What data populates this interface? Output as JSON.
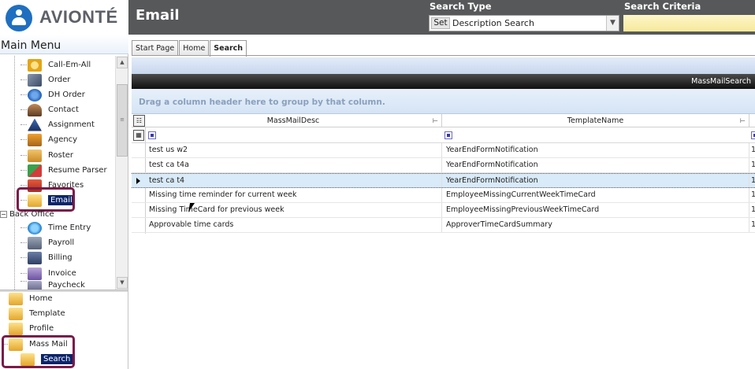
{
  "brand": {
    "name": "AVIONTÉ",
    "color": "#1f6fc0"
  },
  "header": {
    "title": "Email",
    "search_type_label": "Search Type",
    "set_label": "Set",
    "search_type_value": "Description Search",
    "search_criteria_label": "Search Criteria",
    "search_criteria_value": ""
  },
  "sidebar": {
    "title": "Main Menu",
    "items": [
      {
        "label": "Call-Em-All",
        "icon": "phone-icon"
      },
      {
        "label": "Order",
        "icon": "order-icon"
      },
      {
        "label": "DH Order",
        "icon": "globe-icon"
      },
      {
        "label": "Contact",
        "icon": "contact-icon"
      },
      {
        "label": "Assignment",
        "icon": "assignment-icon"
      },
      {
        "label": "Agency",
        "icon": "agency-icon"
      },
      {
        "label": "Roster",
        "icon": "roster-icon"
      },
      {
        "label": "Resume Parser",
        "icon": "resume-icon"
      },
      {
        "label": "Favorites",
        "icon": "favorites-icon"
      },
      {
        "label": "Email",
        "icon": "envelope-icon",
        "selected": true
      }
    ],
    "back_office": {
      "label": "Back Office",
      "items": [
        {
          "label": "Time Entry",
          "icon": "clock-icon"
        },
        {
          "label": "Payroll",
          "icon": "calculator-icon"
        },
        {
          "label": "Billing",
          "icon": "billing-icon"
        },
        {
          "label": "Invoice",
          "icon": "invoice-icon"
        },
        {
          "label": "Paycheck",
          "icon": "paycheck-icon"
        }
      ]
    },
    "email_items": [
      {
        "label": "Home"
      },
      {
        "label": "Template"
      },
      {
        "label": "Profile"
      },
      {
        "label": "Mass Mail"
      },
      {
        "label": "Search",
        "selected": true
      }
    ]
  },
  "tabs": [
    {
      "label": "Start Page"
    },
    {
      "label": "Home"
    },
    {
      "label": "Search",
      "active": true
    }
  ],
  "grid": {
    "panel_title": "MassMailSearch",
    "group_hint": "Drag a column header here to group by that column.",
    "columns": [
      "MassMailDesc",
      "TemplateName"
    ],
    "rows": [
      {
        "desc": "test us w2",
        "template": "YearEndFormNotification",
        "extra": "1"
      },
      {
        "desc": "test ca t4a",
        "template": "YearEndFormNotification",
        "extra": "1"
      },
      {
        "desc": "test ca t4",
        "template": "YearEndFormNotification",
        "extra": "1",
        "selected": true
      },
      {
        "desc": "Missing time reminder for current week",
        "template": "EmployeeMissingCurrentWeekTimeCard",
        "extra": "1"
      },
      {
        "desc": "Missing TimeCard for previous week",
        "template": "EmployeeMissingPreviousWeekTimeCard",
        "extra": "1"
      },
      {
        "desc": "Approvable time cards",
        "template": "ApproverTimeCardSummary",
        "extra": "1"
      }
    ]
  },
  "colors": {
    "header_bg": "#57585a",
    "highlight_border": "#7a1a48",
    "selection": "#0a246a"
  }
}
